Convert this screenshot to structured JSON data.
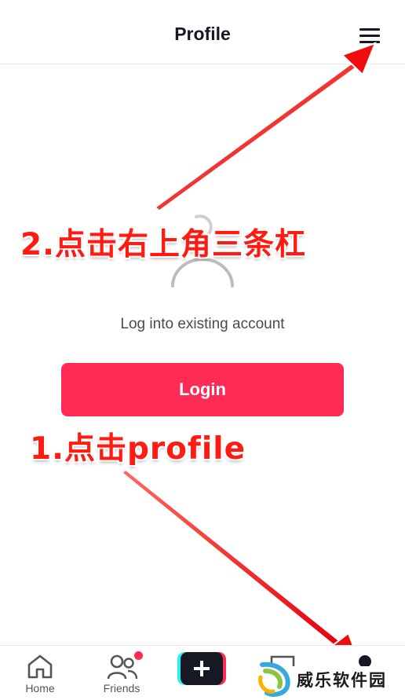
{
  "header": {
    "title": "Profile",
    "menu_icon": "hamburger-icon"
  },
  "profile": {
    "login_hint": "Log into existing account",
    "login_button_label": "Login"
  },
  "annotations": {
    "step2": "2.点击右上角三条杠",
    "step1": "1.点击profile",
    "color": "#ff1a12"
  },
  "bottom_nav": {
    "home_label": "Home",
    "friends_label": "Friends",
    "friends_has_badge": true,
    "create_icon": "plus-icon"
  },
  "watermark": {
    "text": "威乐软件园"
  },
  "colors": {
    "accent": "#fe2c55",
    "text": "#161823"
  }
}
